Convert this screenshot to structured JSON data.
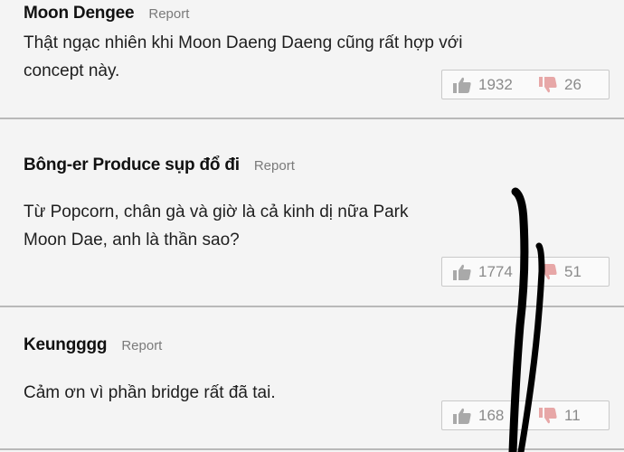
{
  "comments": [
    {
      "author": "Moon Dengee",
      "report_label": "Report",
      "text": "Thật ngạc nhiên khi Moon Daeng Daeng cũng rất hợp với\nconcept này.",
      "likes": "1932",
      "dislikes": "26"
    },
    {
      "author": "Bông-er Produce sụp đổ đi",
      "report_label": "Report",
      "text": "Từ Popcorn, chân gà và giờ là cả kinh dị nữa Park\nMoon Dae, anh là thần sao?",
      "likes": "1774",
      "dislikes": "51"
    },
    {
      "author": "Keungggg",
      "report_label": "Report",
      "text": "Cảm ơn vì phần bridge rất đã tai.",
      "likes": "168",
      "dislikes": "11"
    }
  ],
  "colors": {
    "like_icon": "#a9a9a9",
    "dislike_icon": "#e7a7a7",
    "marker_stroke": "#000000"
  }
}
